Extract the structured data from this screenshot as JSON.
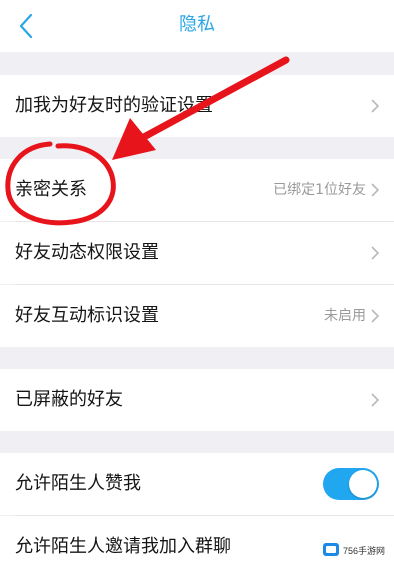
{
  "nav": {
    "title": "隐私",
    "back_icon": "chevron-left-icon"
  },
  "rows": [
    {
      "label": "加我为好友时的验证设置",
      "value": ""
    },
    {
      "label": "亲密关系",
      "value": "已绑定1位好友"
    },
    {
      "label": "好友动态权限设置",
      "value": ""
    },
    {
      "label": "好友互动标识设置",
      "value": "未启用"
    },
    {
      "label": "已屏蔽的好友",
      "value": ""
    },
    {
      "label": "允许陌生人赞我",
      "toggle": true
    },
    {
      "label": "允许陌生人邀请我加入群聊"
    }
  ],
  "watermark": {
    "text": "756手游网"
  },
  "colors": {
    "accent": "#2aa6e6",
    "toggle_on": "#21a7f0",
    "annotation": "#e8141c"
  }
}
